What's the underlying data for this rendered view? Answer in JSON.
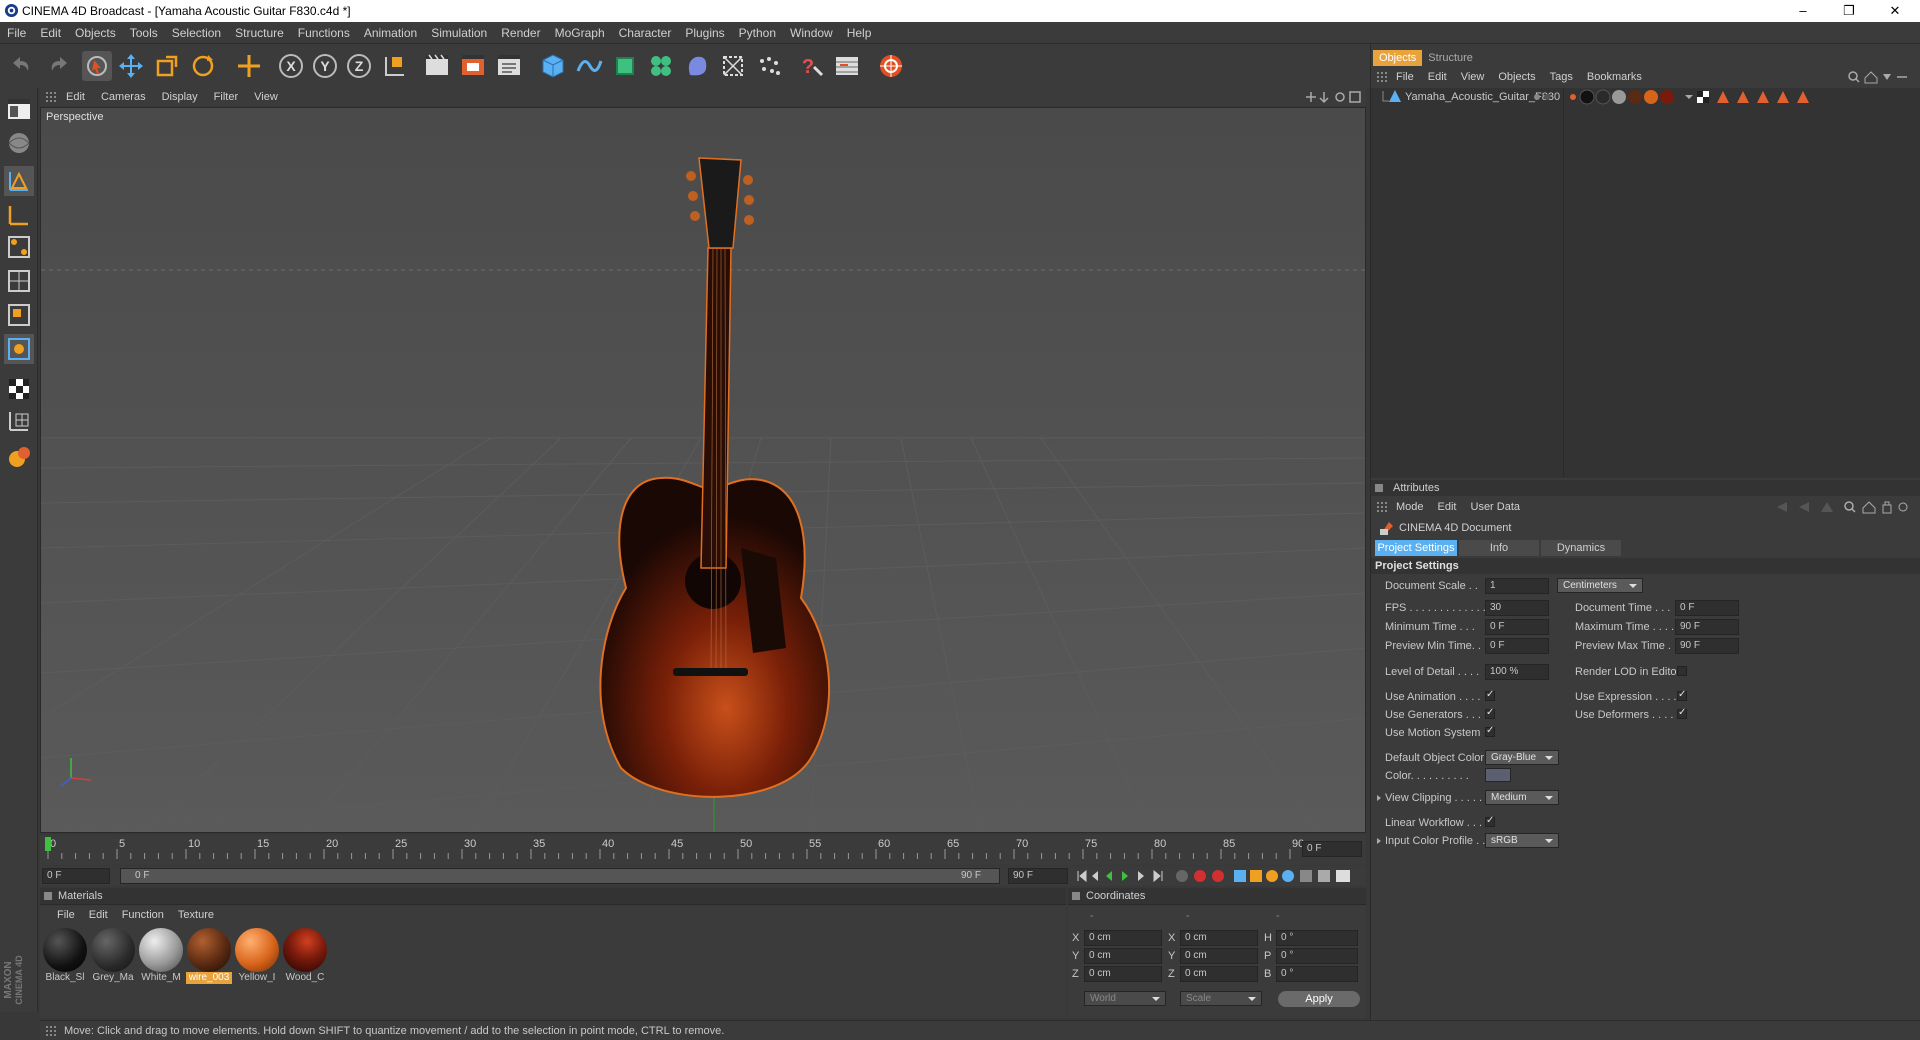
{
  "window": {
    "title": "CINEMA 4D Broadcast - [Yamaha Acoustic Guitar F830.c4d *]"
  },
  "menu": [
    "File",
    "Edit",
    "Objects",
    "Tools",
    "Selection",
    "Structure",
    "Functions",
    "Animation",
    "Simulation",
    "Render",
    "MoGraph",
    "Character",
    "Plugins",
    "Python",
    "Window",
    "Help"
  ],
  "viewport": {
    "menu": [
      "Edit",
      "Cameras",
      "Display",
      "Filter",
      "View"
    ],
    "label": "Perspective"
  },
  "timeline": {
    "ticks": [
      "0",
      "5",
      "10",
      "15",
      "20",
      "25",
      "30",
      "35",
      "40",
      "45",
      "50",
      "55",
      "60",
      "65",
      "70",
      "75",
      "80",
      "85",
      "90"
    ],
    "current": "0 F",
    "start": "0 F",
    "range_start": "0 F",
    "range_end": "90 F",
    "end": "90 F"
  },
  "materials": {
    "title": "Materials",
    "menu": [
      "File",
      "Edit",
      "Function",
      "Texture"
    ],
    "items": [
      {
        "label": "Black_Sl",
        "color": "#111111"
      },
      {
        "label": "Grey_Ma",
        "color": "#2a2a2a"
      },
      {
        "label": "White_M",
        "color": "#9a9a9a"
      },
      {
        "label": "wire_003",
        "color": "#5a2a12",
        "selected": true
      },
      {
        "label": "Yellow_I",
        "color": "#d8641a"
      },
      {
        "label": "Wood_C",
        "color": "#7a1a0c"
      }
    ]
  },
  "coordinates": {
    "title": "Coordinates",
    "header": [
      "-",
      "-",
      "-"
    ],
    "rows": [
      {
        "a": "X",
        "av": "0 cm",
        "b": "X",
        "bv": "0 cm",
        "c": "H",
        "cv": "0 °"
      },
      {
        "a": "Y",
        "av": "0 cm",
        "b": "Y",
        "bv": "0 cm",
        "c": "P",
        "cv": "0 °"
      },
      {
        "a": "Z",
        "av": "0 cm",
        "b": "Z",
        "bv": "0 cm",
        "c": "B",
        "cv": "0 °"
      }
    ],
    "mode1": "World",
    "mode2": "Scale",
    "apply": "Apply"
  },
  "objects": {
    "tabs": [
      "Objects",
      "Structure"
    ],
    "menu": [
      "File",
      "Edit",
      "View",
      "Objects",
      "Tags",
      "Bookmarks"
    ],
    "item": "Yamaha_Acoustic_Guitar_F830"
  },
  "attributes": {
    "title": "Attributes",
    "menu": [
      "Mode",
      "Edit",
      "User Data"
    ],
    "doc": "CINEMA 4D Document",
    "tabs": [
      "Project Settings",
      "Info",
      "Dynamics"
    ],
    "section": "Project Settings",
    "doc_scale_label": "Document Scale . .",
    "doc_scale": "1",
    "doc_unit": "Centimeters",
    "fps_label": "FPS . . . . . . . . . . . . .",
    "fps": "30",
    "doc_time_label": "Document Time . . .",
    "doc_time": "0 F",
    "min_time_label": "Minimum Time . . .",
    "min_time": "0 F",
    "max_time_label": "Maximum Time . . . .",
    "max_time": "90 F",
    "prev_min_label": "Preview Min Time. .",
    "prev_min": "0 F",
    "prev_max_label": "Preview Max Time . .",
    "prev_max": "90 F",
    "lod_label": "Level of Detail . . . .",
    "lod": "100 %",
    "render_lod_label": "Render LOD in Editor",
    "use_anim_label": "Use Animation . . . .",
    "use_expr_label": "Use Expression . . . .",
    "use_gen_label": "Use Generators . . .",
    "use_def_label": "Use Deformers . . . . .",
    "use_motion_label": "Use Motion System",
    "def_color_label": "Default Object Color",
    "def_color": "Gray-Blue",
    "color_label": "Color. . . . . . . . . .",
    "view_clip_label": "View Clipping . . . . .",
    "view_clip": "Medium",
    "linear_label": "Linear Workflow . . .",
    "icp_label": "Input Color Profile . .",
    "icp": "sRGB"
  },
  "status": "Move: Click and drag to move elements. Hold down SHIFT to quantize movement / add to the selection in point mode, CTRL to remove.",
  "brand": "MAXON CINEMA 4D"
}
